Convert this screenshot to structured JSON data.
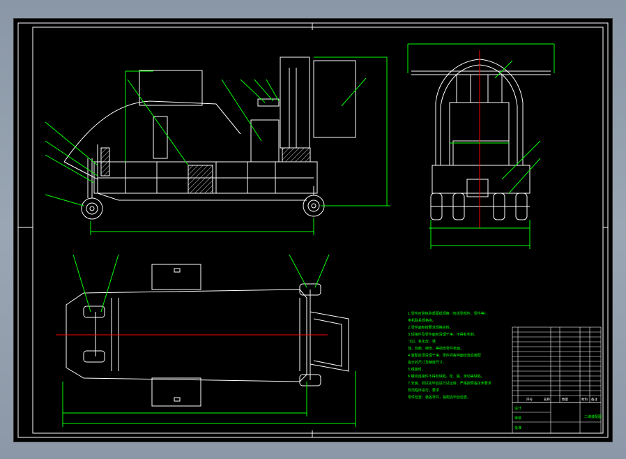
{
  "drawing": {
    "colors": {
      "background": "#000000",
      "outline": "#ffffff",
      "dimension": "#00ff00",
      "centerline": "#ff0000",
      "hatch": "#ffffff"
    },
    "notes_lines": [
      "1.零件应熟练熟悉图纸规格（包括零部件、零件等），",
      "电机联系规格资。",
      "2.零件面积按要求规格资料。",
      "3.焊接件及零件面积清理干净，不得有毛刺、",
      "飞边、氧化皮、锈",
      "蚀、划痕、擦伤、等损伤零件表面。",
      "4.装配前须清理干净，零件间各种面检查后装配",
      "指示的尺寸及精度尺寸。",
      "5.组装时，",
      "6.螺纹连接件不得有缺陷，松、脱、滑动等缺陷。",
      "7.安装、调试完毕后进行试运转，严格按照各技术要求",
      "规范程序进行，要求",
      "零件检查：装各零件，装配完毕后检查。"
    ],
    "title_block": {
      "header_cols": [
        "序号",
        "名称",
        "数量",
        "材料",
        "备注"
      ],
      "drawing_title": "二维装配图",
      "bottom_labels": [
        "设计",
        "审核",
        "批准"
      ]
    }
  }
}
